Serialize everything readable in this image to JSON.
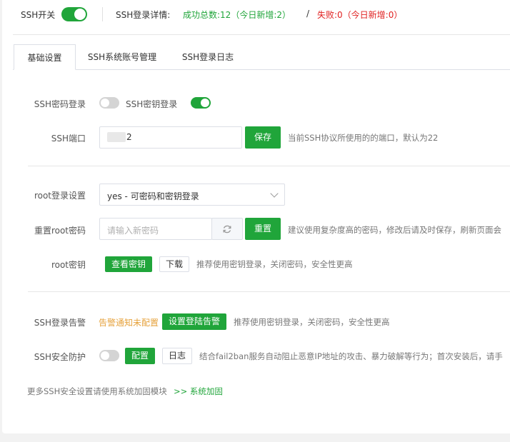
{
  "header": {
    "ssh_switch_label": "SSH开关",
    "login_detail_label": "SSH登录详情:",
    "success_text": "成功总数:12（今日新增:2）",
    "separator": "/",
    "fail_text": "失败:0（今日新增:0）",
    "ssh_switch_on": true
  },
  "tabs": [
    {
      "label": "基础设置",
      "active": true
    },
    {
      "label": "SSH系统账号管理",
      "active": false
    },
    {
      "label": "SSH登录日志",
      "active": false
    }
  ],
  "basic": {
    "password_login_label": "SSH密码登录",
    "key_login_label": "SSH密钥登录",
    "password_login_on": false,
    "key_login_on": true,
    "port_label": "SSH端口",
    "port_value": "2",
    "save_button": "保存",
    "port_hint": "当前SSH协议所使用的的端口，默认为22"
  },
  "root": {
    "login_setting_label": "root登录设置",
    "login_setting_value": "yes - 可密码和密钥登录",
    "reset_password_label": "重置root密码",
    "new_password_placeholder": "请输入新密码",
    "reset_button": "重置",
    "reset_hint": "建议使用复杂度高的密码，修改后请及时保存，刷新页面会",
    "key_label": "root密钥",
    "view_key_button": "查看密钥",
    "download_button": "下载",
    "key_hint": "推荐使用密钥登录，关闭密码，安全性更高"
  },
  "alarm": {
    "label": "SSH登录告警",
    "status_text": "告警通知未配置",
    "set_button": "设置登陆告警",
    "hint": "推荐使用密钥登录，关闭密码，安全性更高"
  },
  "protect": {
    "label": "SSH安全防护",
    "on": false,
    "config_button": "配置",
    "log_button": "日志",
    "hint": "结合fail2ban服务自动阻止恶意IP地址的攻击、暴力破解等行为；首次安装后，请手"
  },
  "footer": {
    "text": "更多SSH安全设置请使用系统加固模块",
    "link": ">> 系统加固"
  },
  "colors": {
    "accent": "#20a53a",
    "fail": "#e02020",
    "warning": "#e6a23c"
  }
}
